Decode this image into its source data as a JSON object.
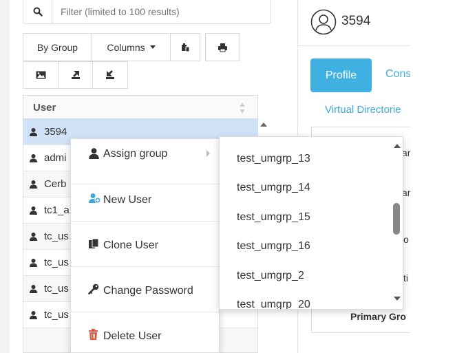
{
  "filter": {
    "placeholder": "Filter (limited to 100 results)",
    "icon": "search-icon"
  },
  "toolbar": {
    "by_group_label": "By Group",
    "columns_label": "Columns",
    "icons": [
      "clipboard-import-icon",
      "print-icon",
      "image-icon",
      "export-icon",
      "import-icon"
    ]
  },
  "table": {
    "header": "User",
    "rows": [
      {
        "name": "3594",
        "selected": true
      },
      {
        "name": "admi"
      },
      {
        "name": "Cerb"
      },
      {
        "name": "tc1_a"
      },
      {
        "name": "tc_us"
      },
      {
        "name": "tc_us"
      },
      {
        "name": "tc_us"
      },
      {
        "name": "tc_us"
      }
    ]
  },
  "context_menu": {
    "items": [
      {
        "label": "Assign group",
        "icon": "user-icon"
      },
      {
        "label": "New User",
        "icon": "add-user-icon"
      },
      {
        "label": "Clone User",
        "icon": "clone-icon"
      },
      {
        "label": "Change Password",
        "icon": "key-icon"
      },
      {
        "label": "Delete User",
        "icon": "trash-icon"
      }
    ]
  },
  "submenu": {
    "items": [
      "test_umgrp_13",
      "test_umgrp_14",
      "test_umgrp_15",
      "test_umgrp_16",
      "test_umgrp_2",
      "test_umgrp_20"
    ]
  },
  "detail": {
    "user_title": "3594",
    "tabs": {
      "profile": "Profile",
      "cons": "Cons"
    },
    "link_virtual_directories": "Virtual Directorie",
    "primary_group_label": "Primary Gro",
    "field_fragments": [
      "ar",
      "ar",
      "o",
      "ti"
    ]
  },
  "colors": {
    "accent": "#3fb0e0",
    "selected_row": "#cfe2f7",
    "delete_icon": "#e2533c",
    "new_user_icon": "#3fa8d8"
  }
}
